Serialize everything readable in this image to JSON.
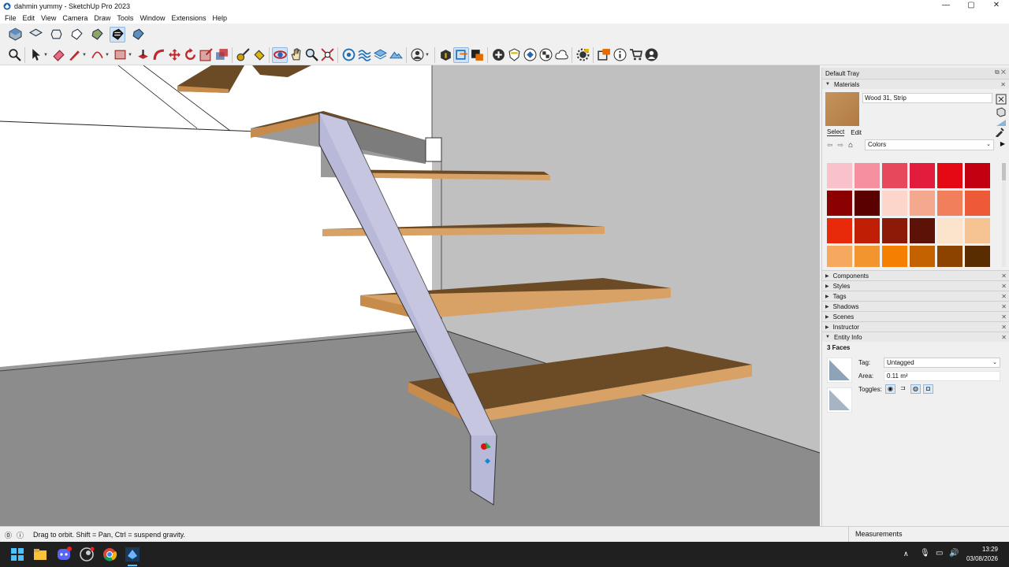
{
  "window": {
    "title": "dahmin yummy - SketchUp Pro 2023",
    "min": "—",
    "max": "▢",
    "close": "✕"
  },
  "menu": [
    "File",
    "Edit",
    "View",
    "Camera",
    "Draw",
    "Tools",
    "Window",
    "Extensions",
    "Help"
  ],
  "toolbar_top": [
    "iso-view-icon",
    "top-view-icon",
    "front-view-icon",
    "right-view-icon",
    "back-view-icon",
    "left-view-icon",
    "bottom-view-icon"
  ],
  "tray": {
    "title": "Default Tray",
    "materials": {
      "header": "Materials",
      "name": "Wood 31, Strip",
      "tab_select": "Select",
      "tab_edit": "Edit",
      "library": "Colors",
      "swatches": [
        "#f9c1c9",
        "#f4909f",
        "#e8485b",
        "#e31c3d",
        "#e50914",
        "#c20012",
        "#8b0000",
        "#5a0000",
        "#fcd6cb",
        "#f4a98f",
        "#f17f5b",
        "#ec5a38",
        "#e92a0a",
        "#c11e06",
        "#8c1a08",
        "#5c1206",
        "#fce3cb",
        "#f6c393",
        "#f5a85e",
        "#f2952e",
        "#f57f00",
        "#c46200",
        "#8c4300",
        "#5a2d00"
      ]
    },
    "panels": [
      "Components",
      "Styles",
      "Tags",
      "Shadows",
      "Scenes",
      "Instructor",
      "Entity Info"
    ],
    "entity_info": {
      "summary": "3 Faces",
      "tag_label": "Tag:",
      "tag_value": "Untagged",
      "area_label": "Area:",
      "area_value": "0.11 m²",
      "toggles_label": "Toggles:"
    }
  },
  "status": {
    "hint": "Drag to orbit. Shift = Pan, Ctrl = suspend gravity.",
    "measurements": "Measurements"
  },
  "taskbar": {
    "time": "13:29",
    "date": "03/08/2026"
  }
}
